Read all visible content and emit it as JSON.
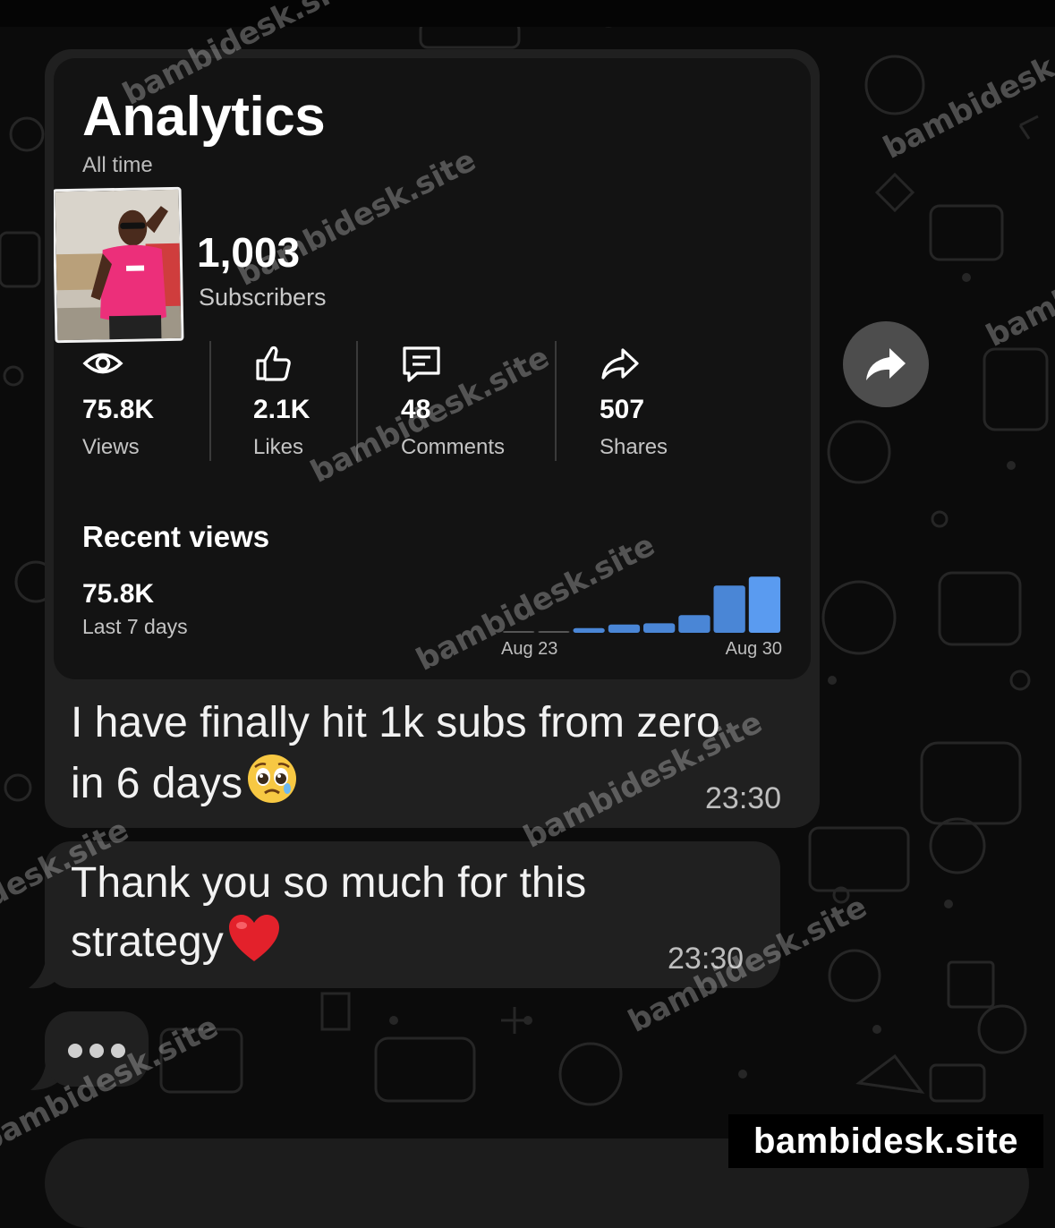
{
  "analytics": {
    "title": "Analytics",
    "subtitle": "All time",
    "subscribers": {
      "count": "1,003",
      "label": "Subscribers"
    },
    "stats": [
      {
        "icon": "eye-icon",
        "value": "75.8K",
        "label": "Views"
      },
      {
        "icon": "thumbs-up-icon",
        "value": "2.1K",
        "label": "Likes"
      },
      {
        "icon": "comment-icon",
        "value": "48",
        "label": "Comments"
      },
      {
        "icon": "share-arrow-icon",
        "value": "507",
        "label": "Shares"
      }
    ],
    "recent_views": {
      "title": "Recent views",
      "value": "75.8K",
      "period": "Last 7 days",
      "start_label": "Aug 23",
      "end_label": "Aug 30",
      "bar_levels": [
        0.02,
        0.02,
        0.08,
        0.14,
        0.16,
        0.3,
        0.8,
        0.95
      ],
      "bar_color": "#4a86d6",
      "bar_color_latest": "#5a9bf0"
    }
  },
  "messages": [
    {
      "text_line1": "I have finally hit 1k subs from zero",
      "text_line2": "in 6 days",
      "emoji": "pleading-face-emoji",
      "time": "23:30"
    },
    {
      "text_line1": "Thank you so much for this",
      "text_line2": "strategy",
      "emoji": "red-heart-emoji",
      "time": "23:30"
    }
  ],
  "typing_indicator": "•••",
  "forward_button": "forward-arrow-icon",
  "watermark": "bambidesk.site",
  "colors": {
    "background": "#0b0b0b",
    "bubble": "#202020",
    "card": "#131313"
  }
}
